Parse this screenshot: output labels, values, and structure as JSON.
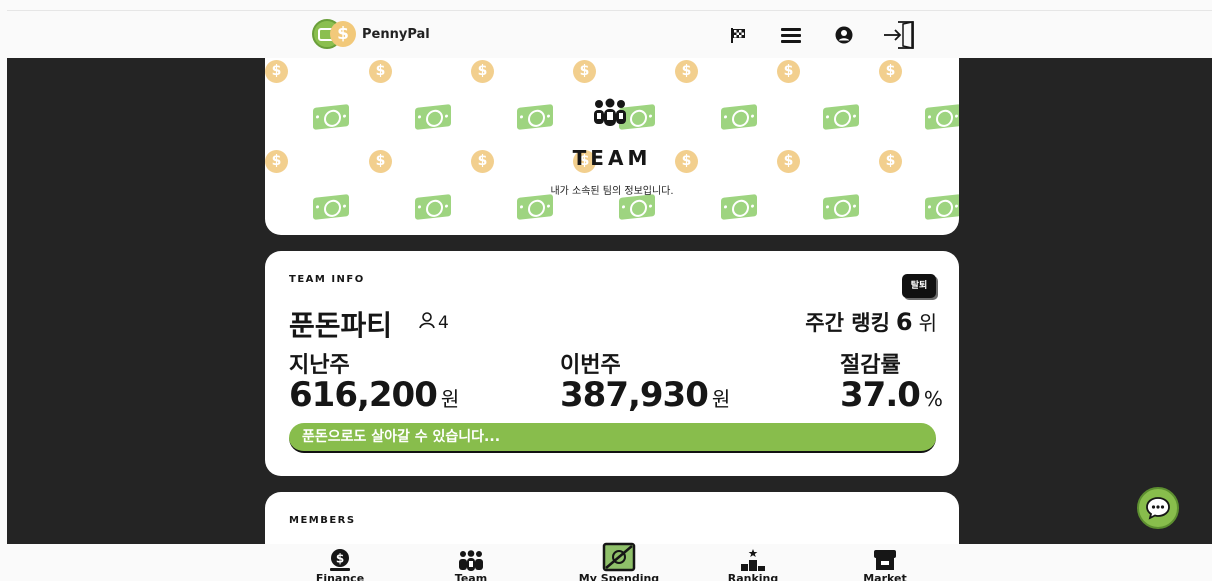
{
  "app": {
    "name": "PennyPal"
  },
  "header": {
    "icons": [
      "flag-icon",
      "menu-icon",
      "user-circle-icon",
      "logout-icon"
    ]
  },
  "hero": {
    "title": "TEAM",
    "subtitle": "내가 소속된 팀의 정보입니다."
  },
  "team_info": {
    "section_label": "TEAM INFO",
    "leave_label": "탈퇴",
    "team_name": "푼돈파티",
    "member_count": "4",
    "ranking_label": "주간 랭킹",
    "ranking_value": "6",
    "ranking_unit": "위",
    "last_week_label": "지난주",
    "last_week_value": "616,200",
    "last_week_unit": "원",
    "this_week_label": "이번주",
    "this_week_value": "387,930",
    "this_week_unit": "원",
    "saving_rate_label": "절감률",
    "saving_rate_value": "37.0",
    "saving_rate_unit": "%",
    "message": "푼돈으로도 살아갈 수 있습니다..."
  },
  "members": {
    "section_label": "MEMBERS"
  },
  "bottom_nav": {
    "items": [
      {
        "label": "Finance",
        "icon": "dollar-coin-icon"
      },
      {
        "label": "Team",
        "icon": "team-icon"
      },
      {
        "label": "My Spending",
        "icon": "spending-icon"
      },
      {
        "label": "Ranking",
        "icon": "podium-icon"
      },
      {
        "label": "Market",
        "icon": "store-icon"
      }
    ]
  },
  "colors": {
    "accent_green": "#88bd4c",
    "coin_yellow": "#f2cf8e",
    "dark_bg": "#242424"
  }
}
